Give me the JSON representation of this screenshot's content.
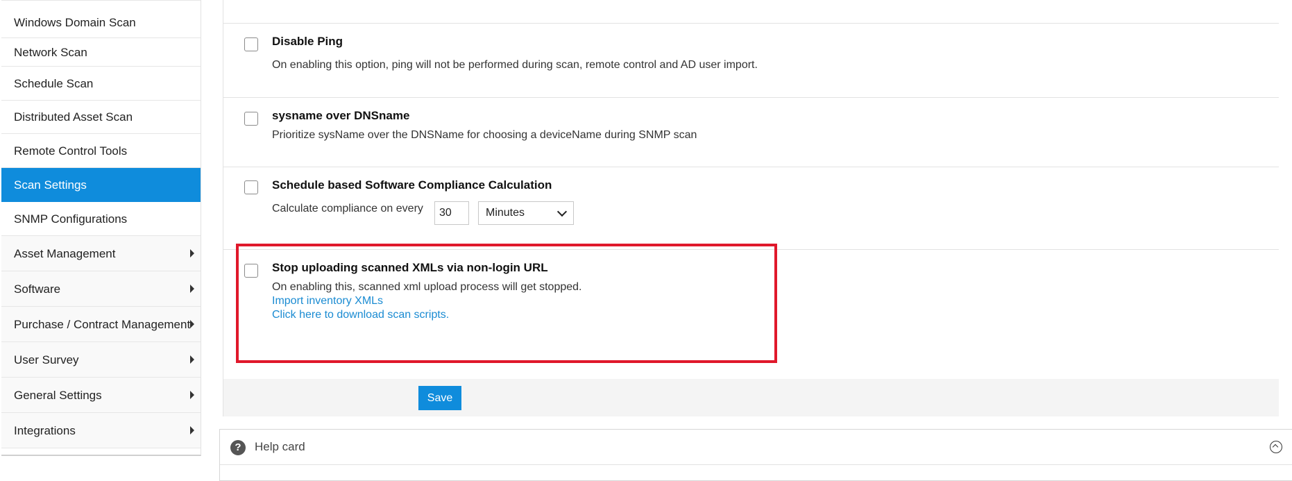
{
  "sidebar": {
    "items": [
      {
        "label": "Windows Domain Scan"
      },
      {
        "label": "Network Scan"
      },
      {
        "label": "Schedule Scan"
      },
      {
        "label": "Distributed Asset Scan"
      },
      {
        "label": "Remote Control Tools"
      },
      {
        "label": "Scan Settings"
      },
      {
        "label": "SNMP Configurations"
      }
    ],
    "parents": [
      {
        "label": "Asset Management"
      },
      {
        "label": "Software"
      },
      {
        "label": "Purchase / Contract Management"
      },
      {
        "label": "User Survey"
      },
      {
        "label": "General Settings"
      },
      {
        "label": "Integrations"
      }
    ],
    "active_item": "Scan Settings"
  },
  "options": {
    "disable_ping": {
      "title": "Disable Ping",
      "description": "On enabling this option, ping will not be performed during scan, remote control and AD user import.",
      "checked": false
    },
    "sysname": {
      "title": "sysname over DNSname",
      "description": "Prioritize sysName over the DNSName for choosing a deviceName during SNMP scan",
      "checked": false
    },
    "compliance": {
      "title": "Schedule based Software Compliance Calculation",
      "description": "Calculate compliance on every",
      "interval_value": "30",
      "interval_unit": "Minutes",
      "checked": false
    },
    "stop_upload": {
      "title": "Stop uploading scanned XMLs via non-login URL",
      "description": "On enabling this, scanned xml upload process will get stopped.",
      "link_import": "Import inventory XMLs",
      "link_download": "Click here to download scan scripts.",
      "checked": false
    }
  },
  "actions": {
    "save_label": "Save"
  },
  "help_card": {
    "title": "Help card",
    "icon": "question-circle-icon"
  },
  "colors": {
    "accent": "#0f8cdc",
    "link": "#1a8bd2",
    "highlight": "#e0182b"
  }
}
